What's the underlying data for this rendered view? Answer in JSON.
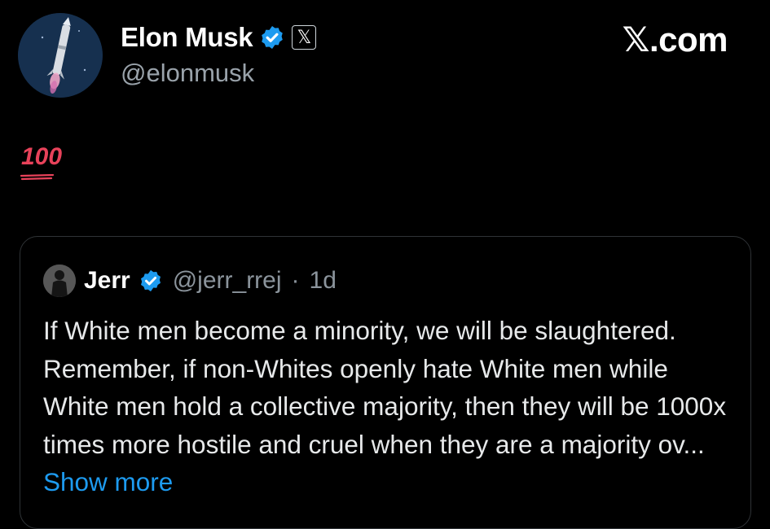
{
  "author": {
    "display_name": "Elon Musk",
    "handle": "@elonmusk",
    "verified_icon": "verified-badge-icon",
    "affiliation_icon": "x-logo-icon",
    "affiliation_glyph": "𝕏"
  },
  "site_label": "𝕏.com",
  "tweet": {
    "text": "100",
    "emoji_name": "hundred-points-emoji"
  },
  "quoted_tweet": {
    "display_name": "Jerr",
    "handle": "@jerr_rrej",
    "separator": "·",
    "age": "1d",
    "body": "If White men become a minority, we will be slaughtered. Remember, if non-Whites openly hate White men while White men hold a collective majority, then they will be 1000x times more hostile and cruel when they are a majority ov...",
    "show_more_label": "Show more"
  },
  "colors": {
    "background": "#000000",
    "verified_blue": "#1d9bf0",
    "emoji_red": "#e8425a",
    "link_blue": "#1d9bf0",
    "secondary_text": "#8b949c"
  }
}
